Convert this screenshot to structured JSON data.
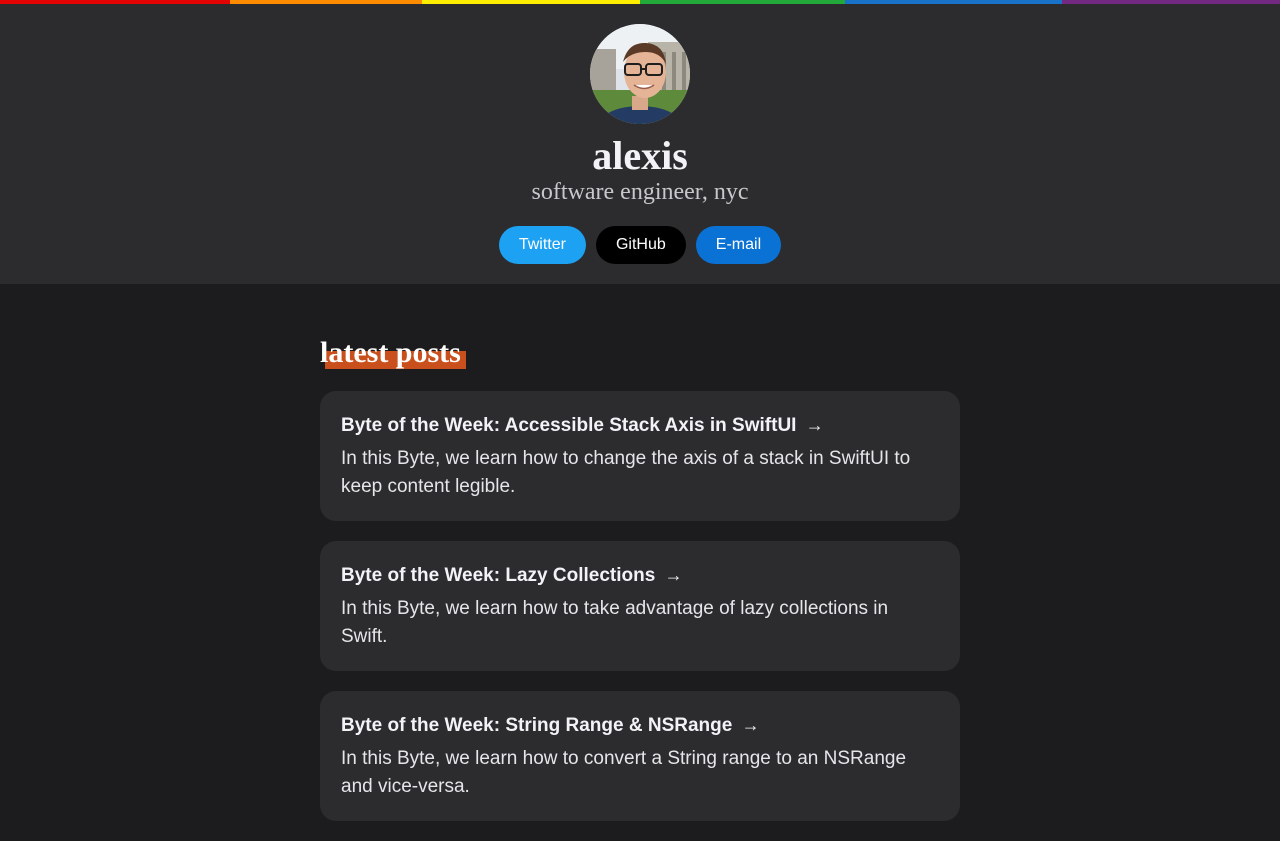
{
  "rainbow_colors": [
    "#e40303",
    "#ff8c00",
    "#ffed00",
    "#22a93a",
    "#1772c8",
    "#732982"
  ],
  "profile": {
    "name": "alexis",
    "tagline": "software engineer, nyc",
    "avatar_icon": "profile-photo"
  },
  "links": [
    {
      "label": "Twitter",
      "color": "#1da1f2"
    },
    {
      "label": "GitHub",
      "color": "#000000"
    },
    {
      "label": "E-mail",
      "color": "#0a72d4"
    }
  ],
  "section": {
    "title": "latest posts",
    "highlight_color": "#c9501c"
  },
  "posts": [
    {
      "title": "Byte of the Week: Accessible Stack Axis in SwiftUI",
      "arrow": "→",
      "description": "In this Byte, we learn how to change the axis of a stack in SwiftUI to keep content legible."
    },
    {
      "title": "Byte of the Week: Lazy Collections",
      "arrow": "→",
      "description": "In this Byte, we learn how to take advantage of lazy collections in Swift."
    },
    {
      "title": "Byte of the Week: String Range & NSRange",
      "arrow": "→",
      "description": "In this Byte, we learn how to convert a String range to an NSRange and vice-versa."
    }
  ]
}
